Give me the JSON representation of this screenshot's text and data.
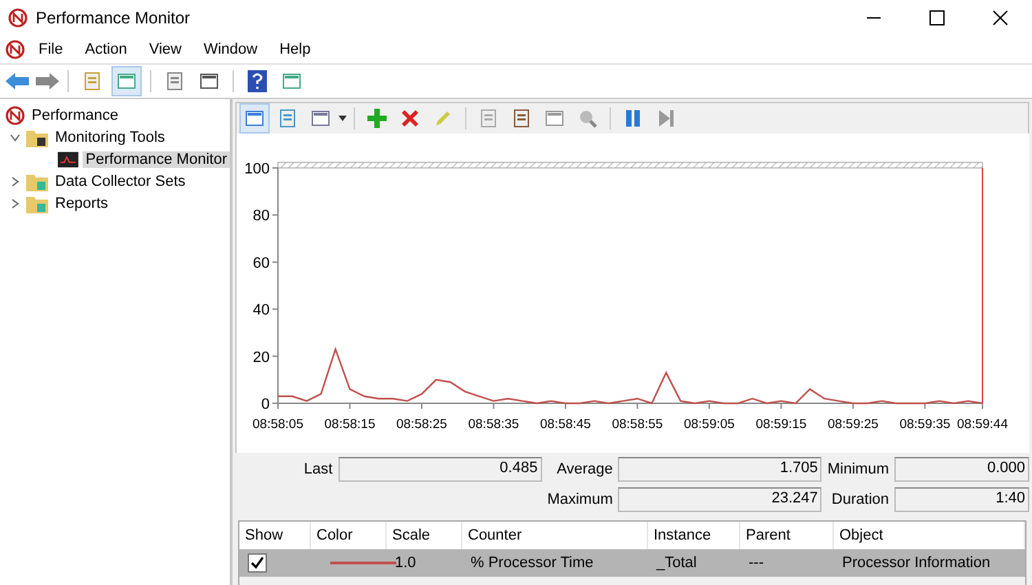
{
  "window": {
    "title": "Performance Monitor"
  },
  "menu": [
    "File",
    "Action",
    "View",
    "Window",
    "Help"
  ],
  "tree": [
    {
      "label": "Performance",
      "kind": "root",
      "selected": false,
      "children": [
        {
          "label": "Monitoring Tools",
          "kind": "folder",
          "expanded": true,
          "selected": false,
          "children": [
            {
              "label": "Performance Monitor",
              "kind": "monitor",
              "selected": true
            }
          ]
        },
        {
          "label": "Data Collector Sets",
          "kind": "folder",
          "expanded": false,
          "selected": false
        },
        {
          "label": "Reports",
          "kind": "folder",
          "expanded": false,
          "selected": false
        }
      ]
    }
  ],
  "chart": {
    "chart_data": {
      "type": "line",
      "categories": [
        "08:58:05",
        null,
        null,
        null,
        null,
        "08:58:15",
        null,
        null,
        null,
        null,
        "08:58:25",
        null,
        null,
        null,
        null,
        "08:58:35",
        null,
        null,
        null,
        null,
        "08:58:45",
        null,
        null,
        null,
        null,
        "08:58:55",
        null,
        null,
        null,
        null,
        "08:59:05",
        null,
        null,
        null,
        null,
        "08:59:15",
        null,
        null,
        null,
        null,
        "08:59:25",
        null,
        null,
        null,
        null,
        "08:59:35",
        null,
        null,
        null,
        "08:59:44"
      ],
      "series": [
        {
          "color": "#c0504d",
          "values": [
            3,
            3,
            1,
            4,
            23,
            6,
            3,
            2,
            2,
            1,
            4,
            10,
            9,
            5,
            3,
            1,
            2,
            1,
            0,
            1,
            0,
            0,
            1,
            0,
            1,
            2,
            0,
            13,
            1,
            0,
            1,
            0,
            0,
            2,
            0,
            1,
            0,
            6,
            2,
            1,
            0,
            0,
            1,
            0,
            0,
            0,
            1,
            0,
            1,
            0
          ]
        }
      ],
      "ylim": [
        0,
        100
      ],
      "yticks": [
        0,
        20,
        40,
        60,
        80,
        100
      ]
    }
  },
  "stats": [
    {
      "label": "Last",
      "value": "0.485"
    },
    {
      "label": "Average",
      "value": "1.705"
    },
    {
      "label": "Minimum",
      "value": "0.000"
    },
    {
      "label": "Maximum",
      "value": "23.247"
    },
    {
      "label": "Duration",
      "value": "1:40"
    }
  ],
  "counters": {
    "columns": [
      "Show",
      "Color",
      "Scale",
      "Counter",
      "Instance",
      "Parent",
      "Object"
    ],
    "rows": [
      {
        "show": true,
        "selected": true,
        "color": "#c0504d",
        "scale": "1.0",
        "counter": "% Processor Time",
        "instance": "_Total",
        "parent": "---",
        "object": "Processor Information"
      }
    ]
  }
}
